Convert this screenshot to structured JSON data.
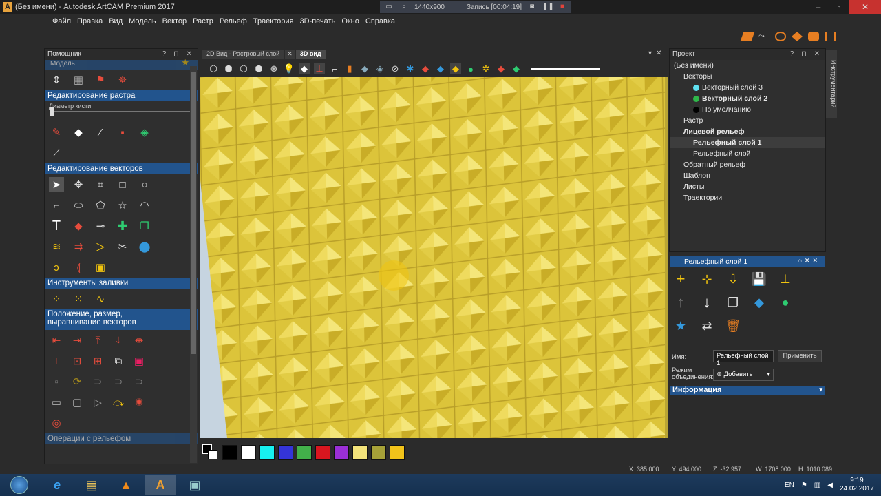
{
  "window": {
    "title": "(Без имени) - Autodesk ArtCAM Premium 2017"
  },
  "recorder": {
    "resolution": "1440x900",
    "status": "Запись [00:04:19]"
  },
  "menu": [
    "Файл",
    "Правка",
    "Вид",
    "Модель",
    "Вектор",
    "Растр",
    "Рельеф",
    "Траектория",
    "3D-печать",
    "Окно",
    "Справка"
  ],
  "assistant": {
    "title": "Помощник",
    "top_label": "Модель",
    "raster_section": "Редактирование растра",
    "brush_label": "Диаметр кисти:",
    "vector_section": "Редактирование векторов",
    "fill_section": "Инструменты заливки",
    "position_section": "Положение, размер, выравнивание векторов",
    "relief_section": "Операции с рельефом"
  },
  "view_tabs": [
    "2D Вид - Растровый слой",
    "3D вид"
  ],
  "colors": {
    "accent": "#22548d",
    "relief": "#e9d24a"
  },
  "swatches": [
    "#000000",
    "#ffffff",
    "#17f0ef",
    "#3434d9",
    "#42b04a",
    "#d9161f",
    "#9a2fd6",
    "#f2e27a",
    "#a6a138",
    "#f2c31a"
  ],
  "project": {
    "title": "Проект",
    "tree": [
      {
        "label": "(Без имени)",
        "indent": 0,
        "bold": false
      },
      {
        "label": "Векторы",
        "indent": 1,
        "bold": false
      },
      {
        "label": "Векторный слой 3",
        "indent": 2,
        "bold": false,
        "dot": "#5fe0f0"
      },
      {
        "label": "Векторный слой 2",
        "indent": 2,
        "bold": true,
        "dot": "#2fb84a"
      },
      {
        "label": "По умолчанию",
        "indent": 2,
        "bold": false,
        "dot": "#000000"
      },
      {
        "label": "Растр",
        "indent": 1,
        "bold": false
      },
      {
        "label": "Лицевой рельеф",
        "indent": 1,
        "bold": true
      },
      {
        "label": "Рельефный слой 1",
        "indent": 2,
        "bold": true
      },
      {
        "label": "Рельефный слой",
        "indent": 2,
        "bold": false
      },
      {
        "label": "Обратный рельеф",
        "indent": 1,
        "bold": false
      },
      {
        "label": "Шаблон",
        "indent": 1,
        "bold": false
      },
      {
        "label": "Листы",
        "indent": 1,
        "bold": false
      },
      {
        "label": "Траектории",
        "indent": 1,
        "bold": false
      }
    ]
  },
  "side_tab": "Инструментарий",
  "layer_panel": {
    "title": "Рельефный слой 1",
    "name_label": "Имя:",
    "name_value": "Рельефный слой 1",
    "apply": "Применить",
    "mode_label": "Режим объединения:",
    "mode_value": "Добавить",
    "info": "Информация"
  },
  "status": {
    "x": "X: 385.000",
    "y": "Y: 494.000",
    "z": "Z: -32.957",
    "w": "W: 1708.000",
    "h": "H: 1010.089"
  },
  "taskbar": {
    "lang": "EN",
    "time": "9:19",
    "date": "24.02.2017"
  }
}
